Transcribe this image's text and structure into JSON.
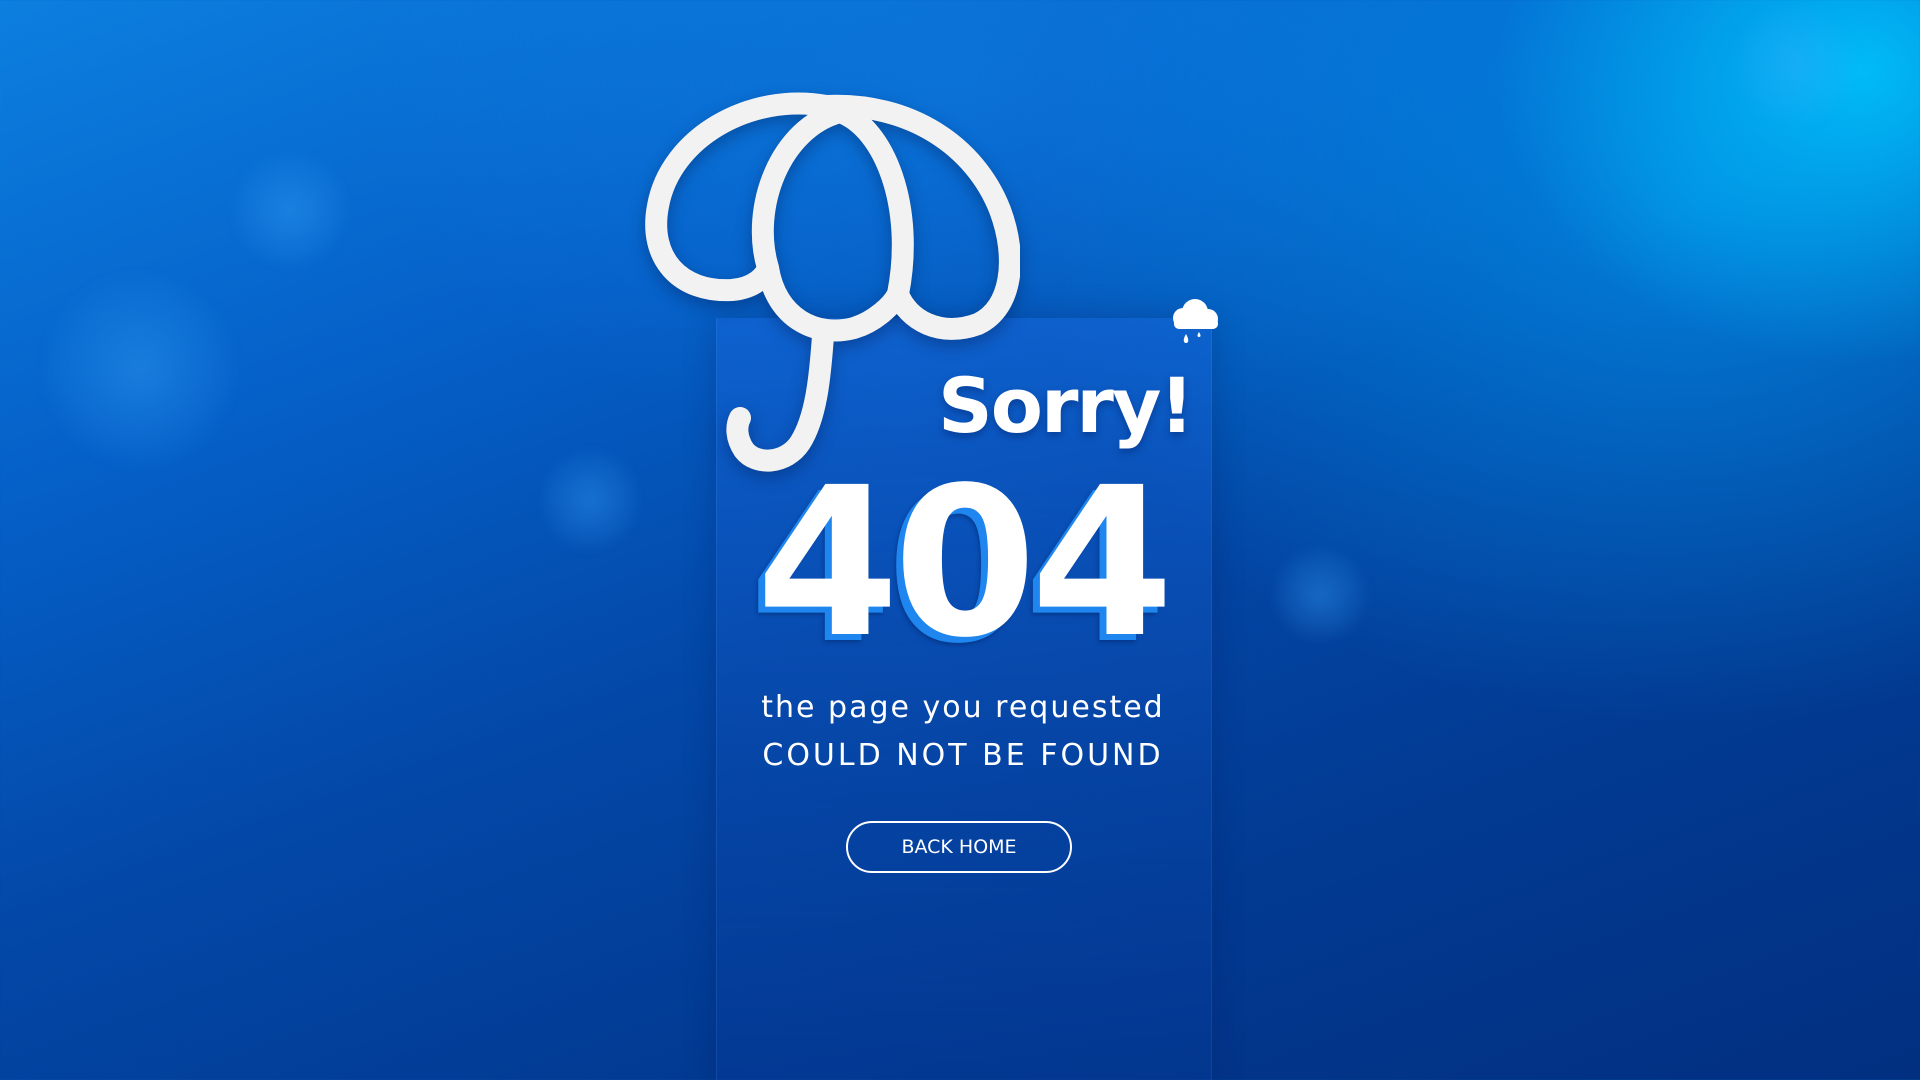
{
  "page": {
    "heading": "Sorry!",
    "error_code": "404",
    "message_line1": "the page you requested",
    "message_line2": "COULD NOT BE FOUND",
    "back_home_label": "BACK HOME"
  },
  "icons": {
    "umbrella": "umbrella-icon",
    "rain_cloud": "rain-cloud-icon"
  },
  "colors": {
    "background_dark": "#022f80",
    "background_light": "#00b4ff",
    "text": "#ffffff",
    "code_shadow": "#1e86ee",
    "umbrella": "#f2f2f2"
  }
}
